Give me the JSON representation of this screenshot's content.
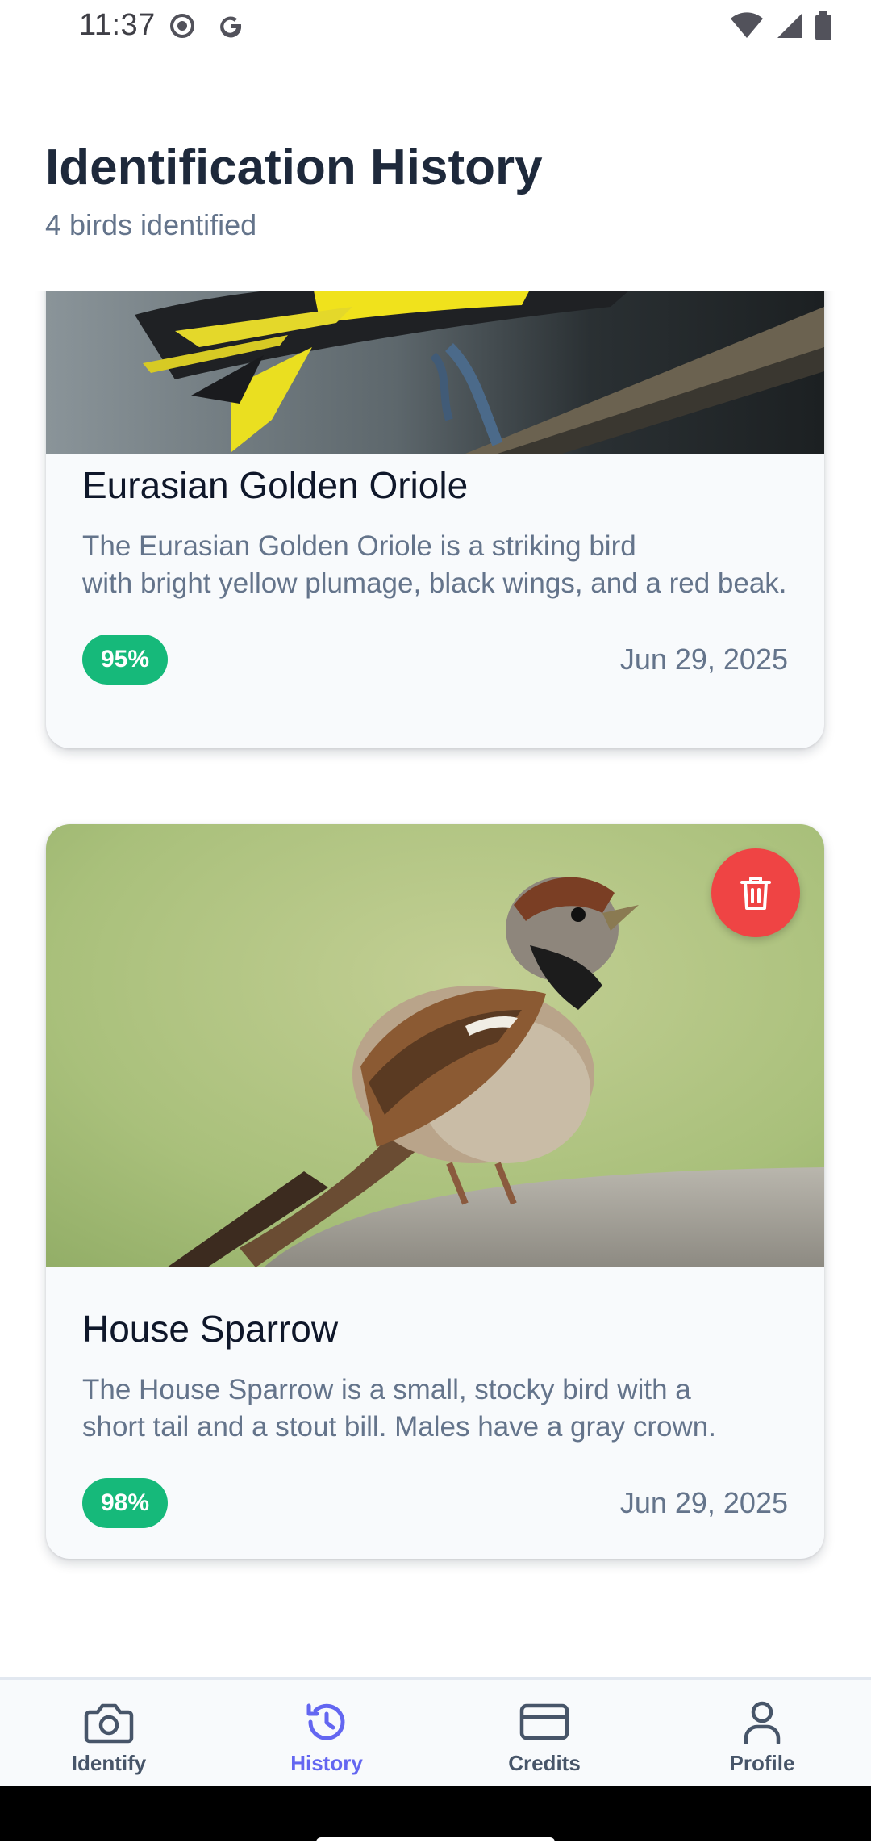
{
  "status_bar": {
    "time": "11:37"
  },
  "header": {
    "title": "Identification History",
    "subtitle": "4 birds identified"
  },
  "cards": [
    {
      "name": "Eurasian Golden Oriole",
      "description_line1": "The Eurasian Golden Oriole is a striking bird",
      "description_line2": "with bright yellow plumage, black wings, and a red beak.",
      "confidence": "95%",
      "date": "Jun 29, 2025"
    },
    {
      "name": "House Sparrow",
      "description_line1": "The House Sparrow is a small, stocky bird with a",
      "description_line2": "short tail and a stout bill. Males have a gray crown.",
      "confidence": "98%",
      "date": "Jun 29, 2025"
    }
  ],
  "bottom_nav": {
    "items": [
      {
        "label": "Identify",
        "icon": "camera-icon"
      },
      {
        "label": "History",
        "icon": "history-icon"
      },
      {
        "label": "Credits",
        "icon": "credit-card-icon"
      },
      {
        "label": "Profile",
        "icon": "user-icon"
      }
    ],
    "active": "History"
  },
  "colors": {
    "accent": "#6366f1",
    "badge": "#16b97a",
    "delete": "#ef4444",
    "title": "#1e293b",
    "muted": "#64748b"
  }
}
